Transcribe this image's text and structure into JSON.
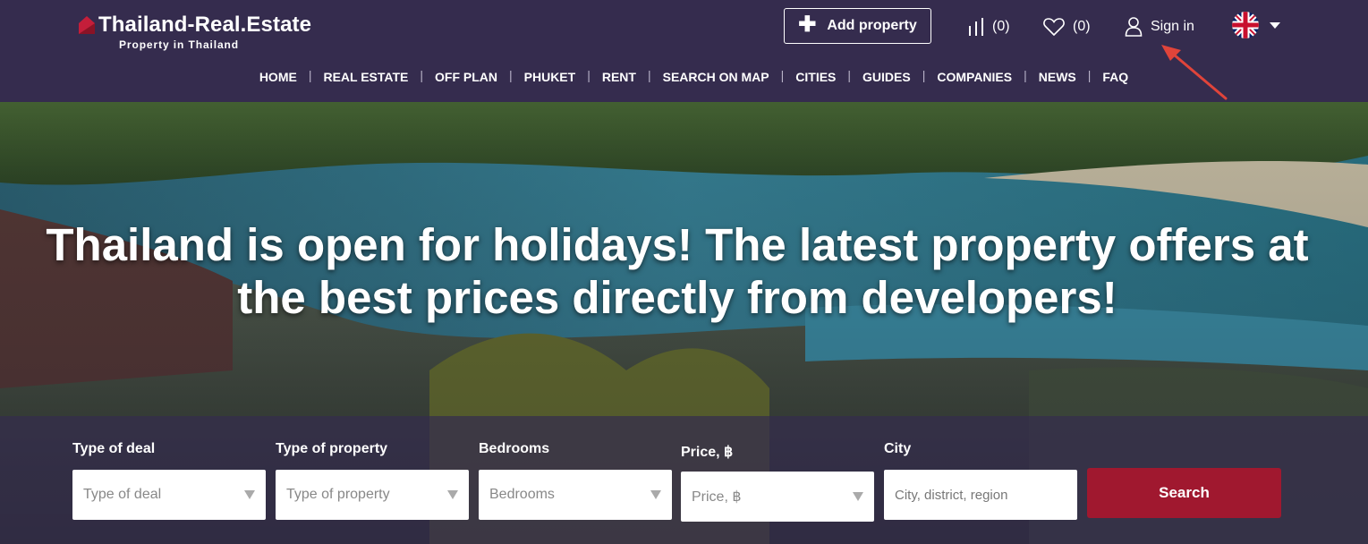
{
  "header": {
    "logo_title": "Thailand-Real.Estate",
    "logo_subtitle": "Property in Thailand",
    "add_property_label": "Add property",
    "compare_count": "(0)",
    "favorites_count": "(0)",
    "sign_in_label": "Sign in",
    "language_flag": "uk-flag-icon"
  },
  "nav": {
    "items": [
      "HOME",
      "REAL ESTATE",
      "OFF PLAN",
      "PHUKET",
      "RENT",
      "SEARCH ON MAP",
      "CITIES",
      "GUIDES",
      "COMPANIES",
      "NEWS",
      "FAQ"
    ]
  },
  "hero": {
    "title": "Thailand is open for holidays! The latest property offers at the best prices directly from developers!"
  },
  "search": {
    "deal_label": "Type of deal",
    "deal_value": "Type of deal",
    "property_label": "Type of property",
    "property_value": "Type of property",
    "bedrooms_label": "Bedrooms",
    "bedrooms_value": "Bedrooms",
    "price_label": "Price, ฿",
    "price_value": "Price, ฿",
    "city_label": "City",
    "city_placeholder": "City, district, region",
    "search_button": "Search"
  },
  "colors": {
    "header_bg": "#352c4e",
    "search_button": "#a0182f",
    "annotation_arrow": "#e0443a"
  }
}
